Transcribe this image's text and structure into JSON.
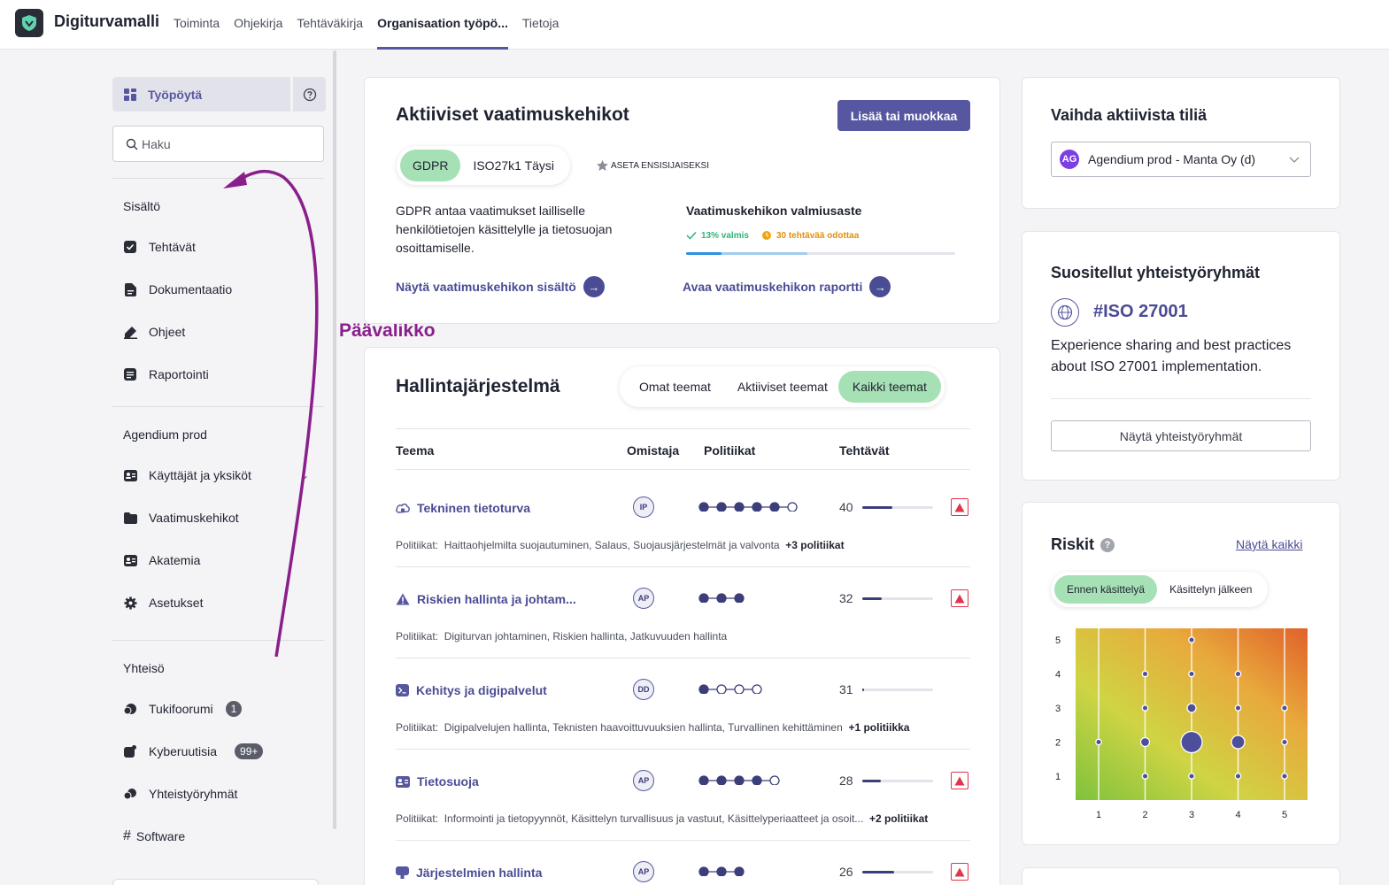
{
  "app": {
    "brand": "Digiturvamalli"
  },
  "nav": {
    "items": [
      {
        "label": "Toiminta",
        "active": false
      },
      {
        "label": "Ohjekirja",
        "active": false
      },
      {
        "label": "Tehtäväkirja",
        "active": false
      },
      {
        "label": "Organisaation työpö...",
        "active": true
      },
      {
        "label": "Tietoja",
        "active": false
      }
    ]
  },
  "sidebar": {
    "dashboard_label": "Työpöytä",
    "search_placeholder": "Haku",
    "sections": [
      {
        "heading": "Sisältö",
        "items": [
          "Tehtävät",
          "Dokumentaatio",
          "Ohjeet",
          "Raportointi"
        ]
      },
      {
        "heading": "Agendium prod",
        "items": [
          "Käyttäjät ja yksiköt",
          "Vaatimuskehikot",
          "Akatemia",
          "Asetukset"
        ]
      },
      {
        "heading": "Yhteisö",
        "items": [
          "Tukifoorumi",
          "Kyberuutisia",
          "Yhteistyöryhmät",
          "Software"
        ]
      }
    ],
    "badges": {
      "tukifoorumi": "1",
      "kyberuutisia": "99+"
    },
    "software_prefix": "#"
  },
  "annotation": {
    "label": "Päävalikko",
    "color": "#8a1f8c"
  },
  "frameworks": {
    "title": "Aktiiviset vaatimuskehikot",
    "edit_button": "Lisää tai muokkaa",
    "tabs": [
      "GDPR",
      "ISO27k1 Täysi"
    ],
    "set_primary": "ASETA ENSISIJAISEKSI",
    "description": "GDPR antaa vaatimukset lailliselle henkilötietojen käsittelylle ja tietosuojan osoittamiselle.",
    "readiness_title": "Vaatimuskehikon valmiusaste",
    "done_text": "13% valmis",
    "pending_text": "30 tehtävää odottaa",
    "done_percent": 13,
    "pending_percent": 45,
    "show_content_link": "Näytä vaatimuskehikon sisältö",
    "open_report_link": "Avaa vaatimuskehikon raportti"
  },
  "management": {
    "title": "Hallintajärjestelmä",
    "filters": [
      "Omat teemat",
      "Aktiiviset teemat",
      "Kaikki teemat"
    ],
    "active_filter": 2,
    "columns": [
      "Teema",
      "Omistaja",
      "Politiikat",
      "Tehtävät"
    ],
    "policies_prefix": "Politiikat:",
    "rows": [
      {
        "name": "Tekninen tietoturva",
        "icon": "cloud-lock-icon",
        "owner": "IP",
        "dots_total": 6,
        "dots_filled": 5,
        "tasks": "40",
        "tasks_fill": 0.42,
        "warning": true,
        "policies": "Haittaohjelmilta suojautuminen, Salaus, Suojausjärjestelmät ja valvonta",
        "more": "+3 politiikat"
      },
      {
        "name": "Riskien hallinta ja johtam...",
        "icon": "warning-triangle-icon",
        "owner": "AP",
        "dots_total": 3,
        "dots_filled": 3,
        "tasks": "32",
        "tasks_fill": 0.28,
        "warning": true,
        "policies": "Digiturvan johtaminen, Riskien hallinta, Jatkuvuuden hallinta",
        "more": ""
      },
      {
        "name": "Kehitys ja digipalvelut",
        "icon": "terminal-icon",
        "owner": "DD",
        "dots_total": 4,
        "dots_filled": 1,
        "tasks": "31",
        "tasks_fill": 0.02,
        "warning": false,
        "policies": "Digipalvelujen hallinta, Teknisten haavoittuvuuksien hallinta, Turvallinen kehittäminen",
        "more": "+1 politiikka"
      },
      {
        "name": "Tietosuoja",
        "icon": "id-card-icon",
        "owner": "AP",
        "dots_total": 5,
        "dots_filled": 4,
        "tasks": "28",
        "tasks_fill": 0.26,
        "warning": true,
        "policies": "Informointi ja tietopyynnöt, Käsittelyn turvallisuus ja vastuut, Käsittelyperiaatteet ja osoit...",
        "more": "+2 politiikat"
      },
      {
        "name": "Järjestelmien hallinta",
        "icon": "monitor-icon",
        "owner": "AP",
        "dots_total": 3,
        "dots_filled": 3,
        "tasks": "26",
        "tasks_fill": 0.45,
        "warning": true,
        "policies": "",
        "more": ""
      }
    ]
  },
  "account": {
    "title": "Vaihda aktiivista tiliä",
    "avatar": "AG",
    "selected": "Agendium prod - Manta Oy (d)"
  },
  "groups": {
    "title": "Suositellut yhteistyöryhmät",
    "group_name": "#ISO 27001",
    "description": "Experience sharing and best practices about ISO 27001 implementation.",
    "button": "Näytä yhteistyöryhmät"
  },
  "risks": {
    "title": "Riskit",
    "show_all": "Näytä kaikki",
    "tabs": [
      "Ennen käsittelyä",
      "Käsittelyn jälkeen"
    ],
    "active_tab": 0
  },
  "chart_data": {
    "type": "scatter",
    "x_ticks": [
      "1",
      "2",
      "3",
      "4",
      "5"
    ],
    "y_ticks": [
      "1",
      "2",
      "3",
      "4",
      "5"
    ],
    "xlim": [
      1,
      5
    ],
    "ylim": [
      1,
      5
    ],
    "grid": true,
    "background": "heatmap-gradient green to orange",
    "points": [
      {
        "x": 1,
        "y": 2,
        "size": "small"
      },
      {
        "x": 2,
        "y": 1,
        "size": "small"
      },
      {
        "x": 2,
        "y": 2,
        "size": "medium"
      },
      {
        "x": 2,
        "y": 3,
        "size": "small"
      },
      {
        "x": 2,
        "y": 4,
        "size": "small"
      },
      {
        "x": 3,
        "y": 1,
        "size": "small"
      },
      {
        "x": 3,
        "y": 2,
        "size": "large"
      },
      {
        "x": 3,
        "y": 3,
        "size": "medium"
      },
      {
        "x": 3,
        "y": 4,
        "size": "small"
      },
      {
        "x": 3,
        "y": 5,
        "size": "small"
      },
      {
        "x": 4,
        "y": 1,
        "size": "small"
      },
      {
        "x": 4,
        "y": 2,
        "size": "medium-large"
      },
      {
        "x": 4,
        "y": 3,
        "size": "small"
      },
      {
        "x": 4,
        "y": 4,
        "size": "small"
      },
      {
        "x": 5,
        "y": 1,
        "size": "small"
      },
      {
        "x": 5,
        "y": 2,
        "size": "small"
      },
      {
        "x": 5,
        "y": 3,
        "size": "small"
      }
    ]
  }
}
